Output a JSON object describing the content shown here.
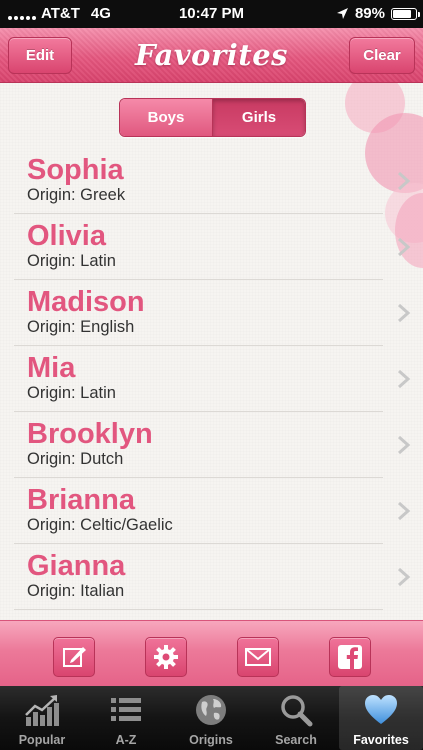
{
  "status_bar": {
    "carrier": "AT&T",
    "network": "4G",
    "time": "10:47 PM",
    "battery": "89%",
    "battery_level": 0.89
  },
  "nav": {
    "title": "Favorites",
    "edit_label": "Edit",
    "clear_label": "Clear"
  },
  "segment": {
    "options": [
      "Boys",
      "Girls"
    ],
    "selected": "Girls"
  },
  "favorites": [
    {
      "name": "Sophia",
      "origin": "Origin: Greek"
    },
    {
      "name": "Olivia",
      "origin": "Origin: Latin"
    },
    {
      "name": "Madison",
      "origin": "Origin: English"
    },
    {
      "name": "Mia",
      "origin": "Origin: Latin"
    },
    {
      "name": "Brooklyn",
      "origin": "Origin: Dutch"
    },
    {
      "name": "Brianna",
      "origin": "Origin: Celtic/Gaelic"
    },
    {
      "name": "Gianna",
      "origin": "Origin: Italian"
    }
  ],
  "toolbar": {
    "buttons": [
      "compose-icon",
      "gear-icon",
      "mail-icon",
      "facebook-icon"
    ]
  },
  "tabs": [
    {
      "label": "Popular",
      "icon": "trend-chart-icon"
    },
    {
      "label": "A-Z",
      "icon": "list-icon"
    },
    {
      "label": "Origins",
      "icon": "globe-icon"
    },
    {
      "label": "Search",
      "icon": "magnifier-icon"
    },
    {
      "label": "Favorites",
      "icon": "heart-icon"
    }
  ],
  "active_tab": "Favorites",
  "colors": {
    "accent_pink": "#e2567f",
    "heart_blue": "#5aa9e6"
  }
}
